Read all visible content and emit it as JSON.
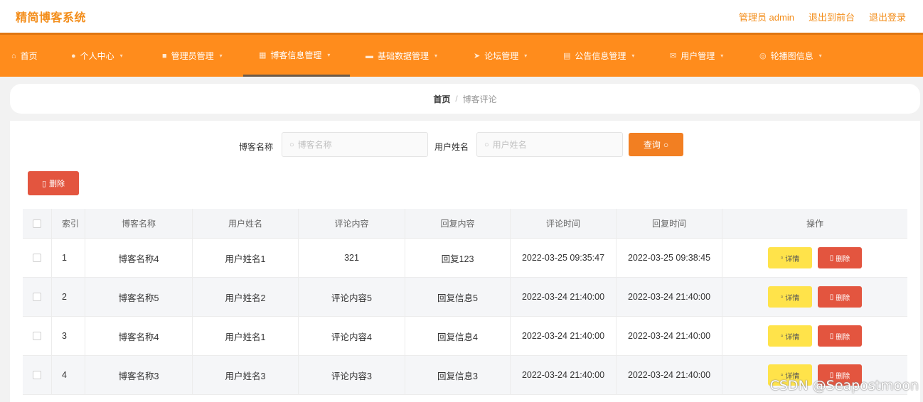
{
  "header": {
    "brand": "精简博客系统",
    "links": [
      "管理员 admin",
      "退出到前台",
      "退出登录"
    ]
  },
  "nav": [
    {
      "label": "首页",
      "icon": "home-icon"
    },
    {
      "label": "个人中心",
      "icon": "user-icon"
    },
    {
      "label": "管理员管理",
      "icon": "chat-icon"
    },
    {
      "label": "博客信息管理",
      "icon": "grid-icon"
    },
    {
      "label": "基础数据管理",
      "icon": "briefcase-icon"
    },
    {
      "label": "论坛管理",
      "icon": "send-icon"
    },
    {
      "label": "公告信息管理",
      "icon": "document-icon"
    },
    {
      "label": "用户管理",
      "icon": "mail-icon"
    },
    {
      "label": "轮播图信息",
      "icon": "image-icon"
    }
  ],
  "breadcrumb": {
    "home": "首页",
    "separator": "/",
    "current": "博客评论"
  },
  "search": {
    "field1_label": "博客名称",
    "field1_placeholder": "博客名称",
    "field2_label": "用户姓名",
    "field2_placeholder": "用户姓名",
    "button": "查询"
  },
  "actions": {
    "delete": "删除"
  },
  "table": {
    "headers": [
      "索引",
      "博客名称",
      "用户姓名",
      "评论内容",
      "回复内容",
      "评论时间",
      "回复时间",
      "操作"
    ],
    "rows": [
      {
        "idx": "1",
        "blog": "博客名称4",
        "user": "用户姓名1",
        "content": "321",
        "reply": "回复123",
        "comment_time": "2022-03-25 09:35:47",
        "reply_time": "2022-03-25 09:38:45"
      },
      {
        "idx": "2",
        "blog": "博客名称5",
        "user": "用户姓名2",
        "content": "评论内容5",
        "reply": "回复信息5",
        "comment_time": "2022-03-24 21:40:00",
        "reply_time": "2022-03-24 21:40:00"
      },
      {
        "idx": "3",
        "blog": "博客名称4",
        "user": "用户姓名1",
        "content": "评论内容4",
        "reply": "回复信息4",
        "comment_time": "2022-03-24 21:40:00",
        "reply_time": "2022-03-24 21:40:00"
      },
      {
        "idx": "4",
        "blog": "博客名称3",
        "user": "用户姓名3",
        "content": "评论内容3",
        "reply": "回复信息3",
        "comment_time": "2022-03-24 21:40:00",
        "reply_time": "2022-03-24 21:40:00"
      }
    ],
    "row_actions": {
      "detail": "详情",
      "delete": "删除"
    }
  },
  "watermark": "CSDN @Seapostmoon",
  "colors": {
    "accent": "#ff8c1c",
    "danger": "#e3553f",
    "warning": "#ffe34a"
  }
}
